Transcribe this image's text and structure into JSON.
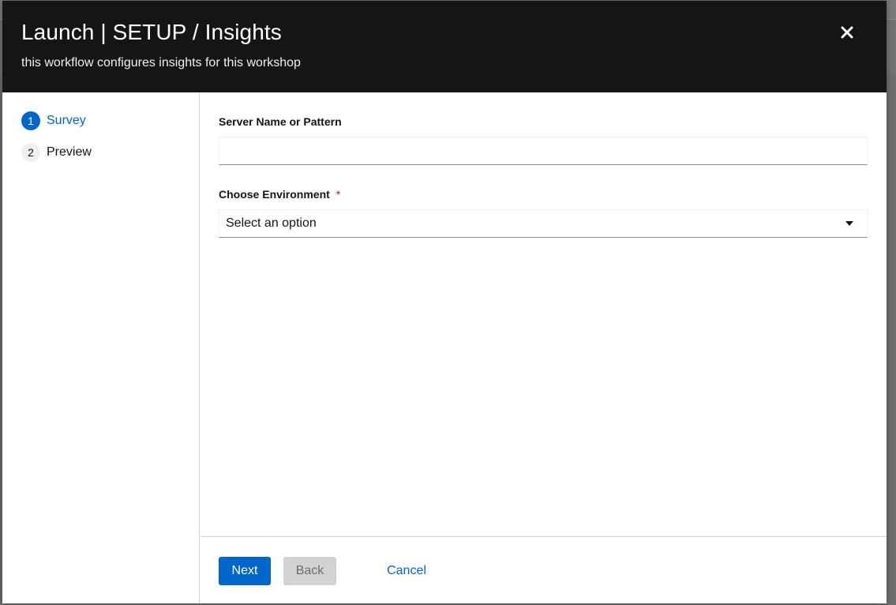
{
  "modal": {
    "title": "Launch | SETUP / Insights",
    "description": "this workflow configures insights for this workshop",
    "close_icon": "close-icon"
  },
  "wizard_nav": {
    "steps": [
      {
        "number": "1",
        "label": "Survey",
        "active": true
      },
      {
        "number": "2",
        "label": "Preview",
        "active": false
      }
    ]
  },
  "form": {
    "server_field": {
      "label": "Server Name or Pattern",
      "value": "",
      "placeholder": ""
    },
    "environment_field": {
      "label": "Choose Environment",
      "required_mark": "*",
      "selected": "Select an option",
      "dropdown_icon": "caret-down-icon"
    }
  },
  "footer": {
    "next_label": "Next",
    "back_label": "Back",
    "cancel_label": "Cancel"
  },
  "colors": {
    "header_bg": "#151515",
    "primary": "#0066cc",
    "required": "#c9190b",
    "disabled_bg": "#d2d2d2"
  }
}
